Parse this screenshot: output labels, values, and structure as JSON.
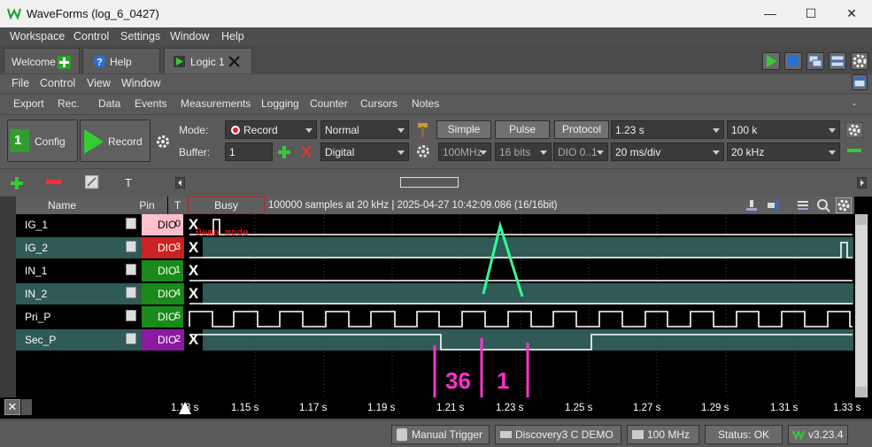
{
  "window": {
    "title": "WaveForms (log_6_0427)",
    "minimize_glyph": "—",
    "maximize_glyph": "☐",
    "close_glyph": "✕"
  },
  "menu": [
    "Workspace",
    "Control",
    "Settings",
    "Window",
    "Help"
  ],
  "tabs": {
    "welcome": "Welcome",
    "help": "Help",
    "logic": "Logic 1"
  },
  "submenu": [
    "File",
    "Control",
    "View",
    "Window"
  ],
  "toolbar": [
    "Export",
    "Rec.",
    "Data",
    "Events",
    "Measurements",
    "Logging",
    "Counter",
    "Cursors",
    "Notes"
  ],
  "toolbar_collapse": "-",
  "controls": {
    "config_label": "Config",
    "config_digit": "1",
    "record_label": "Record",
    "mode_label": "Mode:",
    "mode_value": "Record",
    "buffer_label": "Buffer:",
    "buffer_value": "1",
    "acq_mode": "Normal",
    "source": "Digital",
    "simple": "Simple",
    "pulse": "Pulse",
    "protocol": "Protocol",
    "clock": "100MHz",
    "bits": "16 bits",
    "dio_range": "DIO 0..1",
    "position": "1.23 s",
    "base": "20 ms/div",
    "samples": "100 k",
    "rate": "20 kHz"
  },
  "plot": {
    "header_name": "Name",
    "header_pin": "Pin",
    "header_t": "T",
    "busy": "Busy",
    "info": "100000 samples at 20 kHz | 2025-04-27 10:42:09.086 (16/16bit)",
    "demo_mode": "Demo mode",
    "channels": [
      {
        "name": "IG_1",
        "pin": "DIO",
        "num": "0",
        "trig": "X",
        "color": "#ffc0cb",
        "text": "#000000"
      },
      {
        "name": "IG_2",
        "pin": "DIO",
        "num": "3",
        "trig": "X",
        "color": "#cc2222",
        "text": "#ffffff"
      },
      {
        "name": "IN_1",
        "pin": "DIO",
        "num": "1",
        "trig": "X",
        "color": "#1a8a1a",
        "text": "#ffffff"
      },
      {
        "name": "IN_2",
        "pin": "DIO",
        "num": "4",
        "trig": "X",
        "color": "#1a8a1a",
        "text": "#ffffff"
      },
      {
        "name": "Pri_P",
        "pin": "DIO",
        "num": "5",
        "trig": "",
        "color": "#1a8a1a",
        "text": "#ffffff"
      },
      {
        "name": "Sec_P",
        "pin": "DIO",
        "num": "2",
        "trig": "X",
        "color": "#8a1aa0",
        "text": "#ffffff"
      }
    ],
    "time_labels": [
      "1.13 s",
      "1.15 s",
      "1.17 s",
      "1.19 s",
      "1.21 s",
      "1.23 s",
      "1.25 s",
      "1.27 s",
      "1.29 s",
      "1.31 s",
      "1.33 s"
    ],
    "annotation_left": "36",
    "annotation_right": "1"
  },
  "status": {
    "manual_trigger": "Manual Trigger",
    "device": "Discovery3 C DEMO",
    "clock": "100 MHz",
    "status": "Status: OK",
    "version": "v3.23.4"
  },
  "colors": {
    "accent_green": "#33cc33",
    "annotation": "#ff33cc",
    "marker_green": "#33ff99"
  }
}
